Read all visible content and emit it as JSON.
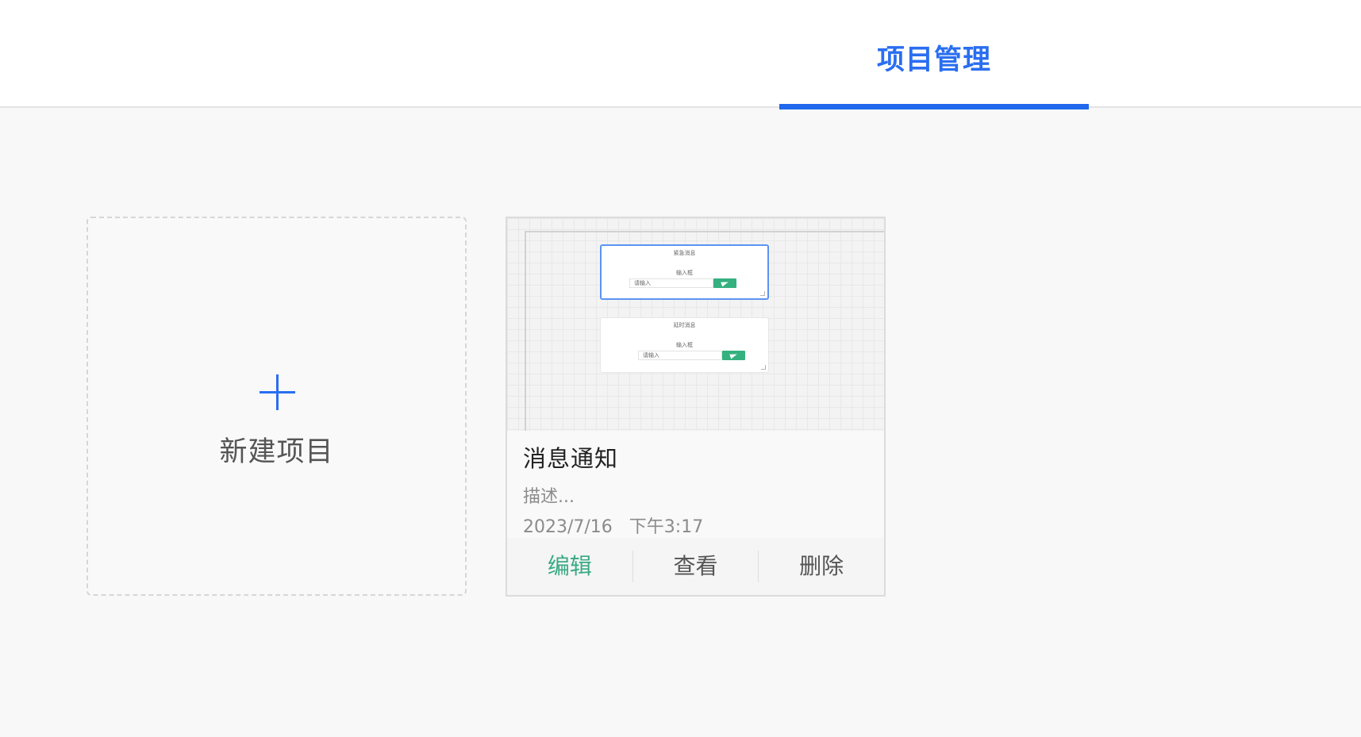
{
  "header": {
    "tab_label": "项目管理",
    "accent_color": "#2068ec"
  },
  "new_project": {
    "label": "新建项目",
    "icon": "plus-icon"
  },
  "projects": [
    {
      "title": "消息通知",
      "description": "描述...",
      "date": "2023/7/16",
      "time": "下午3:17",
      "actions": {
        "edit": "编辑",
        "view": "查看",
        "delete": "删除"
      },
      "thumbnail": {
        "panels": [
          {
            "title": "紧急消息",
            "input_label": "输入框",
            "placeholder": "请输入"
          },
          {
            "title": "延时消息",
            "input_label": "输入框",
            "placeholder": "请输入"
          }
        ]
      }
    }
  ]
}
